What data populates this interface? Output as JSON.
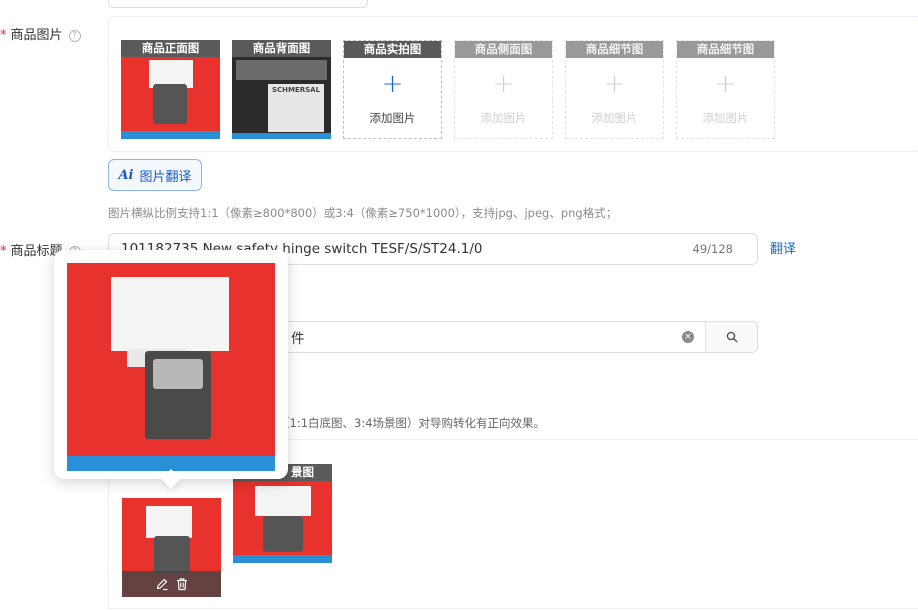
{
  "product_images": {
    "label": "商品图片",
    "help_glyph": "?",
    "slots": [
      {
        "caption": "商品正面图",
        "state": "filled"
      },
      {
        "caption": "商品背面图",
        "state": "filled"
      },
      {
        "caption": "商品实拍图",
        "state": "empty-active",
        "add_label": "添加图片"
      },
      {
        "caption": "商品侧面图",
        "state": "empty-disabled",
        "add_label": "添加图片"
      },
      {
        "caption": "商品细节图",
        "state": "empty-disabled",
        "add_label": "添加图片"
      },
      {
        "caption": "商品细节图",
        "state": "empty-disabled",
        "add_label": "添加图片"
      }
    ],
    "translate_button": {
      "ai_glyph": "Ai",
      "label": "图片翻译"
    },
    "hint": "图片横纵比例支持1:1（像素≥800*800）或3:4（像素≥750*1000），支持jpg、jpeg、png格式；"
  },
  "product_title": {
    "label": "商品标题",
    "help_glyph": "?",
    "value": "101182735 New safety hinge switch TESF/S/ST24.1/0",
    "count": "49/128",
    "translate_link": "翻译"
  },
  "category_search": {
    "value": "件",
    "clear_glyph": "×"
  },
  "scene_images": {
    "hint": "（1:1白底图、3:4场景图）对导购转化有正向效果。",
    "second_caption": "景图"
  },
  "colors": {
    "accent": "#1a66cc",
    "required": "#f5222d",
    "photo_red": "#e8322e"
  }
}
